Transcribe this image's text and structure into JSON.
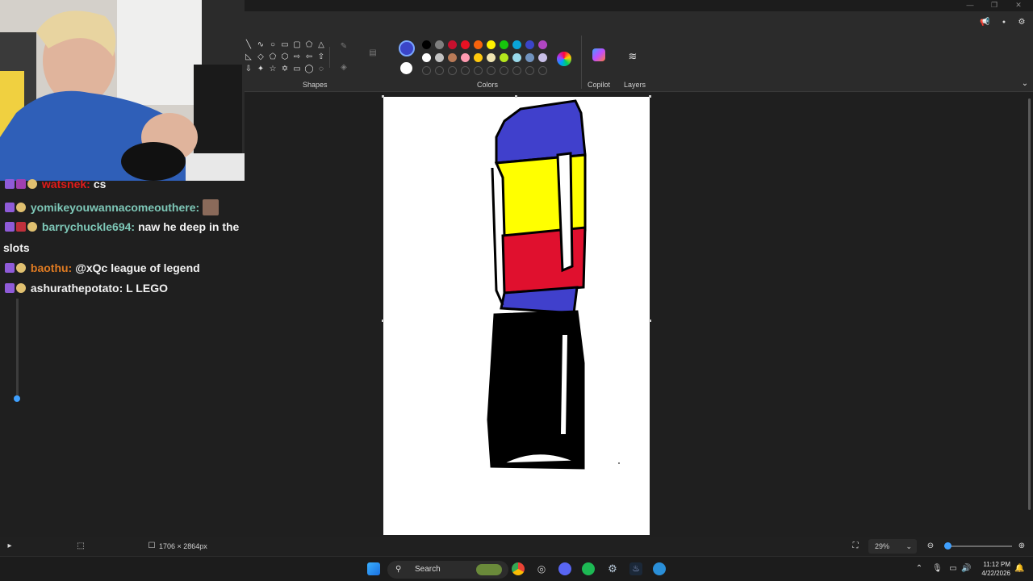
{
  "ribbon": {
    "shapes_label": "Shapes",
    "colors_label": "Colors",
    "copilot_label": "Copilot",
    "layers_label": "Layers",
    "selected_color": "#3b45c8",
    "secondary_color": "#ffffff",
    "palette_row1": [
      "#000000",
      "#7f7f7f",
      "#c8102e",
      "#e81123",
      "#f7630c",
      "#fff100",
      "#16c60c",
      "#0aa4d8",
      "#3b45c8",
      "#b146c2"
    ],
    "palette_row2": [
      "#ffffff",
      "#c3c3c3",
      "#b97a57",
      "#ff9ab0",
      "#ffc90e",
      "#efe4b0",
      "#b5e61d",
      "#99d9ea",
      "#7092be",
      "#c8bfe7"
    ]
  },
  "chat": {
    "messages": [
      {
        "user": "watsnek:",
        "text": "cs",
        "color": "#e01b1b"
      },
      {
        "user": "yomikeyouwannacomeouthere:",
        "text": "",
        "color": "#7ec8b8"
      },
      {
        "user": "barrychuckle694:",
        "text": "naw he deep in the",
        "color": "#7ec8b8"
      },
      {
        "user": "",
        "text": "slots",
        "color": "#f2f2f2"
      },
      {
        "user": "baothu:",
        "text": "@xQc league of legend",
        "color": "#e07b22"
      },
      {
        "user": "",
        "text": "ashurathepotato: L LEGO",
        "color": "#f2f2f2"
      }
    ]
  },
  "status": {
    "canvas_size": "1706 × 2864px",
    "zoom": "29%"
  },
  "taskbar": {
    "search_label": "Search",
    "time": "11:12 PM",
    "date": "4/22/2026"
  }
}
